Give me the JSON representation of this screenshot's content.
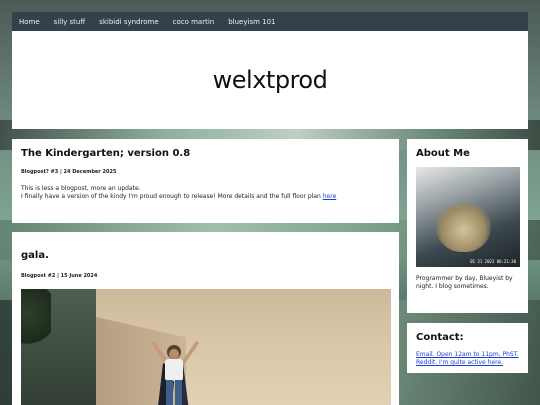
{
  "nav": {
    "items": [
      "Home",
      "silly stuff",
      "skibidi syndrome",
      "coco martin",
      "blueyism 101"
    ]
  },
  "header": {
    "title": "welxtprod"
  },
  "posts": [
    {
      "title": "The Kindergarten; version 0.8",
      "meta": "Blogpost? #3 | 24 December 2025",
      "line1": "This is less a blogpost, more an update.",
      "line2": "I finally have a version of the kindy I'm proud enough to release! More details and the full floor plan ",
      "link": "here"
    },
    {
      "title": "gala.",
      "meta": "Blogpost #2 | 15 June 2024"
    }
  ],
  "about": {
    "title": "About Me",
    "photo_timestamp": "01 21 2023 06:21:30",
    "text": "Programmer by day, Blueyist by night. I blog sometimes."
  },
  "contact": {
    "title": "Contact:",
    "email": "Email. Open 12am to 11pm, PhST.",
    "reddit": "Reddit. I'm quite active here."
  },
  "colors": {
    "nav_bg": "#34404a",
    "link": "#1a3fd0",
    "card_bg": "#ffffff"
  }
}
